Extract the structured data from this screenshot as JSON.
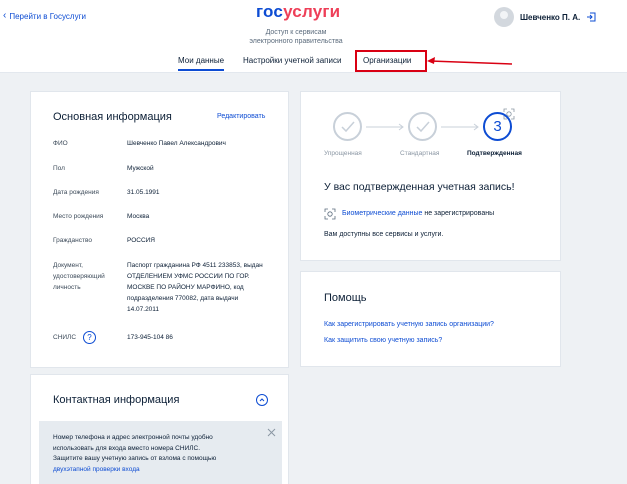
{
  "header": {
    "back_link": "Перейти в Госуслуги",
    "logo_part1": "гос",
    "logo_part2": "услуги",
    "tagline_line1": "Доступ к сервисам",
    "tagline_line2": "электронного правительства",
    "user_name": "Шевченко П. А."
  },
  "tabs": [
    {
      "label": "Мои данные",
      "active": true
    },
    {
      "label": "Настройки учетной записи",
      "active": false
    },
    {
      "label": "Организации",
      "active": false
    }
  ],
  "main_info": {
    "title": "Основная информация",
    "edit_link": "Редактировать",
    "rows": [
      {
        "label": "ФИО",
        "value": "Шевченко Павел Александрович"
      },
      {
        "label": "Пол",
        "value": "Мужской"
      },
      {
        "label": "Дата рождения",
        "value": "31.05.1991"
      },
      {
        "label": "Место рождения",
        "value": "Москва"
      },
      {
        "label": "Гражданство",
        "value": "РОССИЯ"
      },
      {
        "label": "Документ, удостоверяющий личность",
        "value": "Паспорт гражданина РФ 4511 233853, выдан ОТДЕЛЕНИЕМ УФМС РОССИИ ПО ГОР. МОСКВЕ ПО РАЙОНУ МАРФИНО, код подразделения 770082, дата выдачи 14.07.2011"
      },
      {
        "label": "СНИЛС",
        "value": "173-945-104 86"
      }
    ],
    "help_glyph": "?"
  },
  "account_status": {
    "steps": [
      {
        "label": "Упрощенная",
        "state": "done"
      },
      {
        "label": "Стандартная",
        "state": "done"
      },
      {
        "label": "Подтвержденная",
        "state": "current",
        "number": "3"
      }
    ],
    "heading": "У вас подтвержденная учетная запись!",
    "biometric_link": "Биометрические данные",
    "biometric_text": "не зарегистрированы",
    "services_text": "Вам доступны все сервисы и услуги."
  },
  "help": {
    "title": "Помощь",
    "links": [
      "Как зарегистрировать учетную запись организации?",
      "Как защитить свою учетную запись?"
    ]
  },
  "contact": {
    "title": "Контактная информация",
    "notice_line1": "Номер телефона и адрес электронной почты удобно",
    "notice_line2": "использовать для входа вместо номера СНИЛС.",
    "notice_line3": "Защитите вашу учетную запись от взлома с помощью",
    "notice_link": "двухэтапной проверки входа"
  },
  "colors": {
    "accent": "#0d4cd3",
    "brand_red": "#ee3f58",
    "highlight": "#d90013"
  }
}
